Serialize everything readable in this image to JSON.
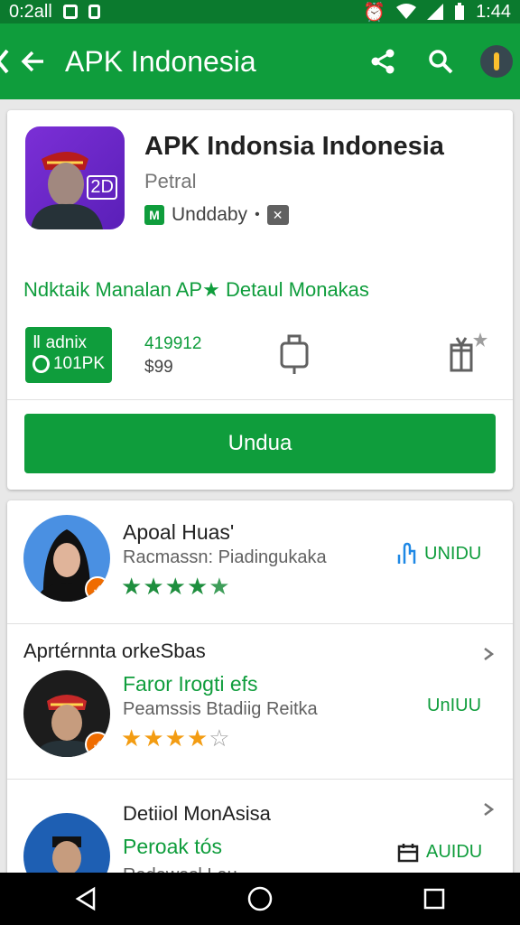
{
  "status_bar": {
    "left_text": "0:2all",
    "time": "1:44"
  },
  "app_bar": {
    "title": "APK Indonesia"
  },
  "app_detail": {
    "name": "APK Indonsia Indonesia",
    "developer": "Petral",
    "update_label": "Unddaby",
    "separator": "•",
    "icon_badge": "2D",
    "tagline": "Ndktaik Manalan AP★ Detaul Monakas",
    "version_badge_line1": "Ⅱ adnix",
    "version_badge_line2": "101PK",
    "stats_number": "419912",
    "stats_price": "$99",
    "install_button": "Undua"
  },
  "list": {
    "items": [
      {
        "title": "Apoal Huas'",
        "subtitle": "Racmassn: Piadingukaka",
        "rating": 5,
        "action_label": "UNIDU"
      },
      {
        "section_title": "Aprtérnnta orkeSbas",
        "title": "Faror Irogti efs",
        "subtitle": "Peamssis Btadiig Reitka",
        "rating": 4,
        "action_label": "UnIUU"
      },
      {
        "section_title": "Detiiol MonAsisa",
        "title": "Peroak tós",
        "subtitle": "Radawasl Lau",
        "action_label": "AUIDU"
      }
    ]
  },
  "colors": {
    "primary": "#0f9d3c",
    "status_bar": "#0b7a2e",
    "star_green": "#1e8e3e",
    "star_orange": "#f39c12",
    "badge_orange": "#ef6c00"
  }
}
